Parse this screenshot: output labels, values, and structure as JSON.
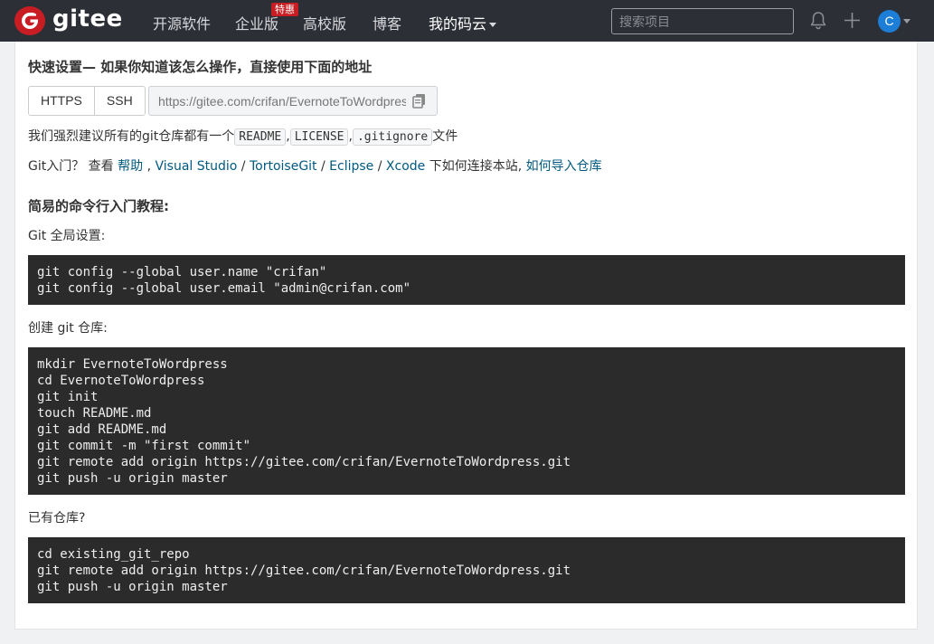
{
  "navbar": {
    "brand": "gitee",
    "items": [
      {
        "label": "开源软件"
      },
      {
        "label": "企业版"
      },
      {
        "label": "高校版"
      },
      {
        "label": "博客"
      },
      {
        "label": "我的码云"
      }
    ],
    "badge": "特惠",
    "search_placeholder": "搜索项目",
    "avatar_letter": "C"
  },
  "quick_setup": {
    "title": "快速设置— 如果你知道该怎么操作，直接使用下面的地址",
    "protocols": [
      "HTTPS",
      "SSH"
    ],
    "url": "https://gitee.com/crifan/EvernoteToWordpress.git",
    "recommend_prefix": "我们强烈建议所有的git仓库都有一个",
    "recommend_files": [
      "README",
      "LICENSE",
      ".gitignore"
    ],
    "recommend_sep1": ",",
    "recommend_sep2": ",",
    "recommend_suffix": "文件",
    "git_intro_prefix": "Git入门？ 查看",
    "links": {
      "help": "帮助",
      "visual_studio": "Visual Studio",
      "tortoisegit": "TortoiseGit",
      "eclipse": "Eclipse",
      "xcode": "Xcode",
      "import": "如何导入仓库"
    },
    "sep_comma": ",",
    "sep_slash": "/",
    "connect_text": "下如何连接本站,"
  },
  "tutorial": {
    "title": "简易的命令行入门教程:",
    "global_label": "Git 全局设置:",
    "global_code": "git config --global user.name \"crifan\"\ngit config --global user.email \"admin@crifan.com\"",
    "create_label": "创建 git 仓库:",
    "create_code": "mkdir EvernoteToWordpress\ncd EvernoteToWordpress\ngit init\ntouch README.md\ngit add README.md\ngit commit -m \"first commit\"\ngit remote add origin https://gitee.com/crifan/EvernoteToWordpress.git\ngit push -u origin master",
    "existing_label": "已有仓库?",
    "existing_code": "cd existing_git_repo\ngit remote add origin https://gitee.com/crifan/EvernoteToWordpress.git\ngit push -u origin master"
  },
  "colors": {
    "navbar_bg": "#2d2f36",
    "brand_red": "#c71d23",
    "link": "#005980",
    "code_bg": "#2b2b2b"
  }
}
